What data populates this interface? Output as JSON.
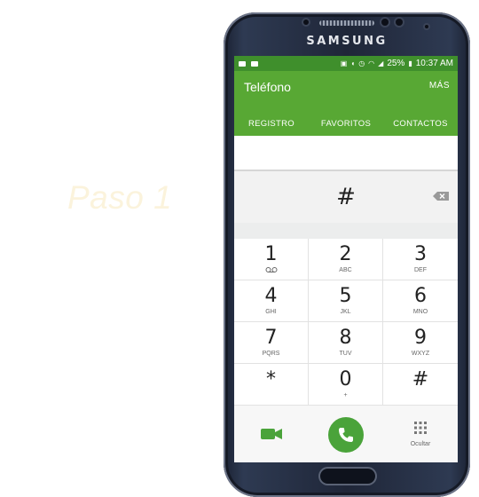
{
  "overlay": {
    "step_label": "Paso 1"
  },
  "device": {
    "brand": "SAMSUNG"
  },
  "status_bar": {
    "battery": "25%",
    "time": "10:37 AM"
  },
  "app": {
    "title": "Teléfono",
    "more": "MÁS",
    "tabs": [
      {
        "label": "REGISTRO"
      },
      {
        "label": "FAVORITOS"
      },
      {
        "label": "CONTACTOS"
      }
    ]
  },
  "dialer": {
    "entered_number": "#",
    "keys": [
      {
        "digit": "1",
        "letters": ""
      },
      {
        "digit": "2",
        "letters": "ABC"
      },
      {
        "digit": "3",
        "letters": "DEF"
      },
      {
        "digit": "4",
        "letters": "GHI"
      },
      {
        "digit": "5",
        "letters": "JKL"
      },
      {
        "digit": "6",
        "letters": "MNO"
      },
      {
        "digit": "7",
        "letters": "PQRS"
      },
      {
        "digit": "8",
        "letters": "TUV"
      },
      {
        "digit": "9",
        "letters": "WXYZ"
      },
      {
        "digit": "*",
        "letters": ""
      },
      {
        "digit": "0",
        "letters": "+"
      },
      {
        "digit": "#",
        "letters": ""
      }
    ],
    "hide_label": "Ocultar"
  },
  "colors": {
    "appbar": "#58a834",
    "status_bar": "#3f8f2c",
    "call_button": "#4aa33a"
  }
}
